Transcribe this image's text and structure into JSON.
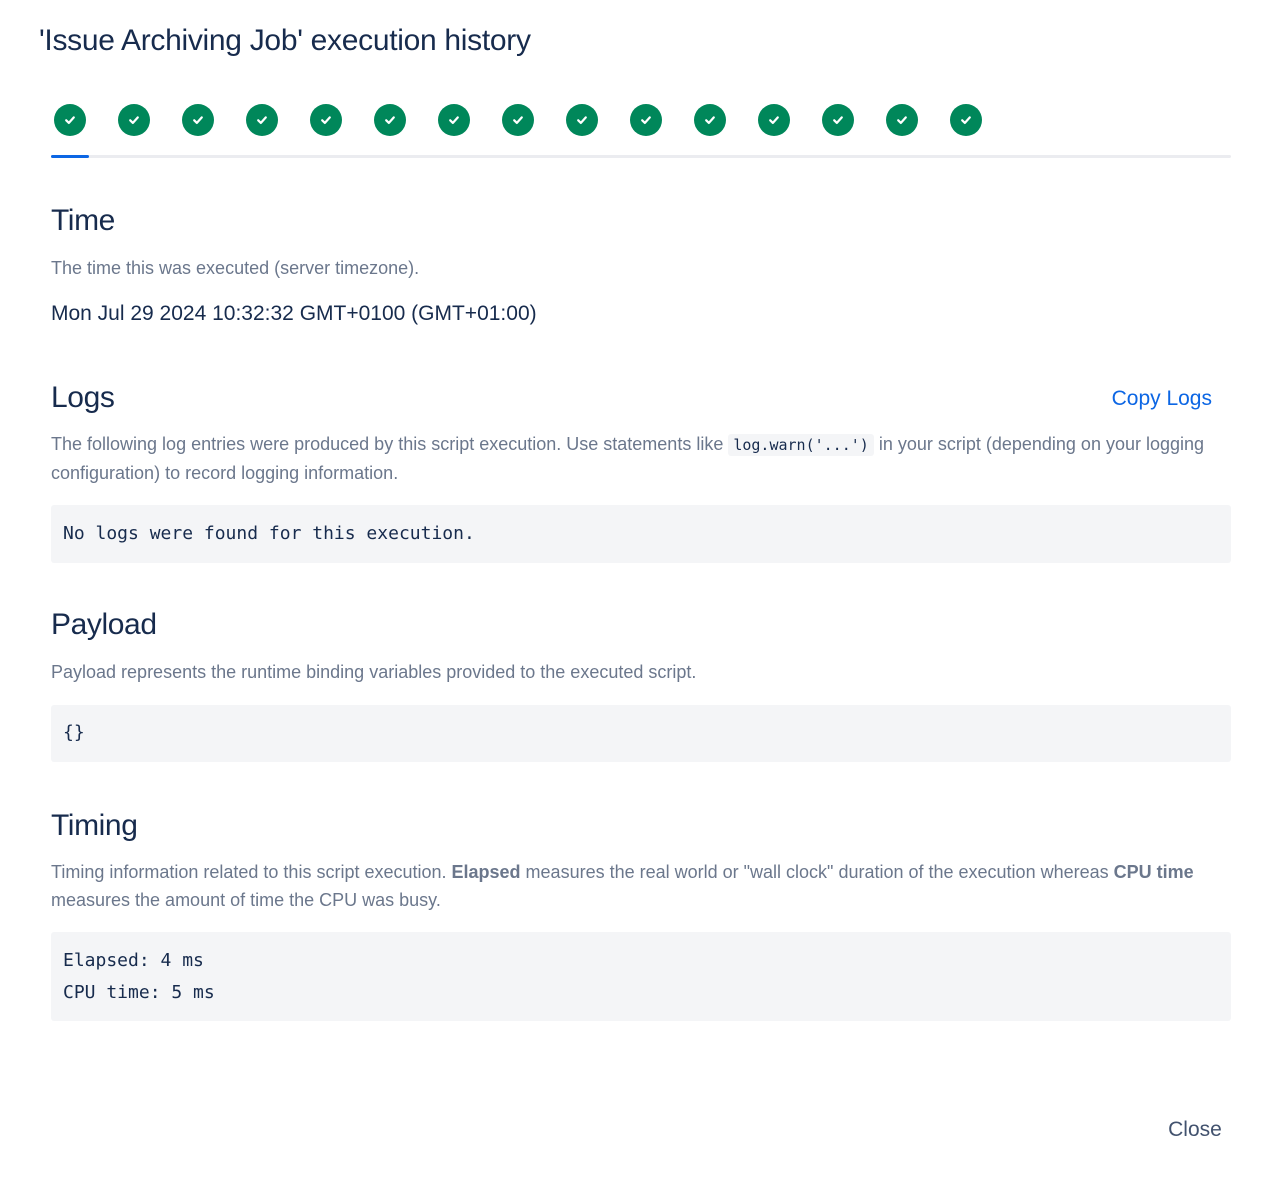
{
  "dialog": {
    "title": "'Issue Archiving Job' execution history",
    "close_label": "Close"
  },
  "executions": {
    "count": 15,
    "active_index": 0,
    "status": "success",
    "status_icon": "check-circle-icon",
    "status_color": "#00875a",
    "accent_color": "#0c66e4"
  },
  "time": {
    "heading": "Time",
    "description": "The time this was executed (server timezone).",
    "value": "Mon Jul 29 2024 10:32:32 GMT+0100 (GMT+01:00)"
  },
  "logs": {
    "heading": "Logs",
    "copy_label": "Copy Logs",
    "description_before": "The following log entries were produced by this script execution. Use statements like ",
    "description_code": "log.warn('...')",
    "description_after": " in your script (depending on your logging configuration) to record logging information.",
    "content": "No logs were found for this execution."
  },
  "payload": {
    "heading": "Payload",
    "description": "Payload represents the runtime binding variables provided to the executed script.",
    "content": "{}"
  },
  "timing": {
    "heading": "Timing",
    "description_1": "Timing information related to this script execution. ",
    "elapsed_term": "Elapsed",
    "description_2": " measures the real world or \"wall clock\" duration of the execution whereas ",
    "cpu_term": "CPU time",
    "description_3": " measures the amount of time the CPU was busy.",
    "elapsed_line": "Elapsed: 4 ms",
    "cpu_line": "CPU time: 5 ms"
  }
}
